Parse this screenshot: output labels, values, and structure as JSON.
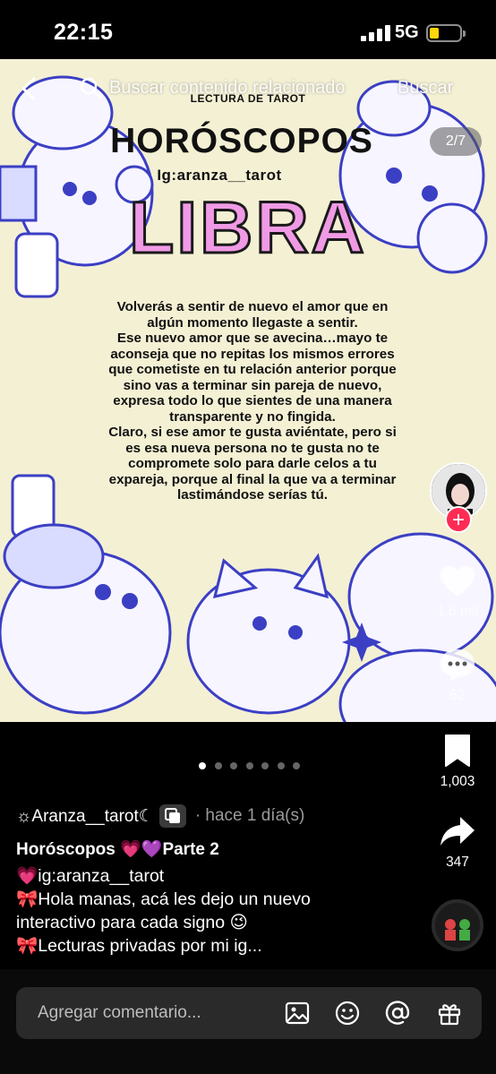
{
  "status_bar": {
    "time": "22:15",
    "network": "5G"
  },
  "search": {
    "placeholder": "Buscar contenido relacionado",
    "button": "Buscar"
  },
  "post": {
    "header_small": "LECTURA DE TAROT",
    "title": "HORÓSCOPOS",
    "handle": "Ig:aranza__tarot",
    "sign": "LIBRA",
    "counter": "2/7",
    "reading": "Volverás a sentir de nuevo el amor que en\nalgún momento llegaste a sentir.\nEse nuevo amor que se avecina…mayo  te\naconseja que no repitas los mismos errores\nque cometiste en tu relación anterior porque\nsino vas a terminar sin pareja de nuevo,\nexpresa todo lo que sientes de una manera\ntransparente y no fingida.\nClaro, si ese amor te gusta aviéntate, pero si\nes esa nueva persona no te gusta no te\ncompromete solo para darle celos a tu\nexpareja, porque al final la que va a terminar\nlastimándose serías tú."
  },
  "actions": {
    "follow": "+",
    "likes": "1.6 mil",
    "comments": "62",
    "saves": "1,003",
    "shares": "347"
  },
  "pagination": {
    "count": 7,
    "active": 0
  },
  "caption": {
    "author": "☼Aranza__tarot☾",
    "time": "· hace 1 día(s)",
    "title": "Horóscopos 💗💜Parte 2",
    "lines": [
      "💗ig:aranza__tarot",
      "🎀Hola manas, acá les dejo un nuevo",
      "interactivo para cada signo 😉",
      "🎀Lecturas privadas por mi ig..."
    ]
  },
  "comment_bar": {
    "placeholder": "Agregar comentario..."
  },
  "colors": {
    "accent": "#fe2c55",
    "libra": "#f09ae6",
    "post_bg": "#f4f0d4",
    "ink": "#3b3fc4"
  }
}
